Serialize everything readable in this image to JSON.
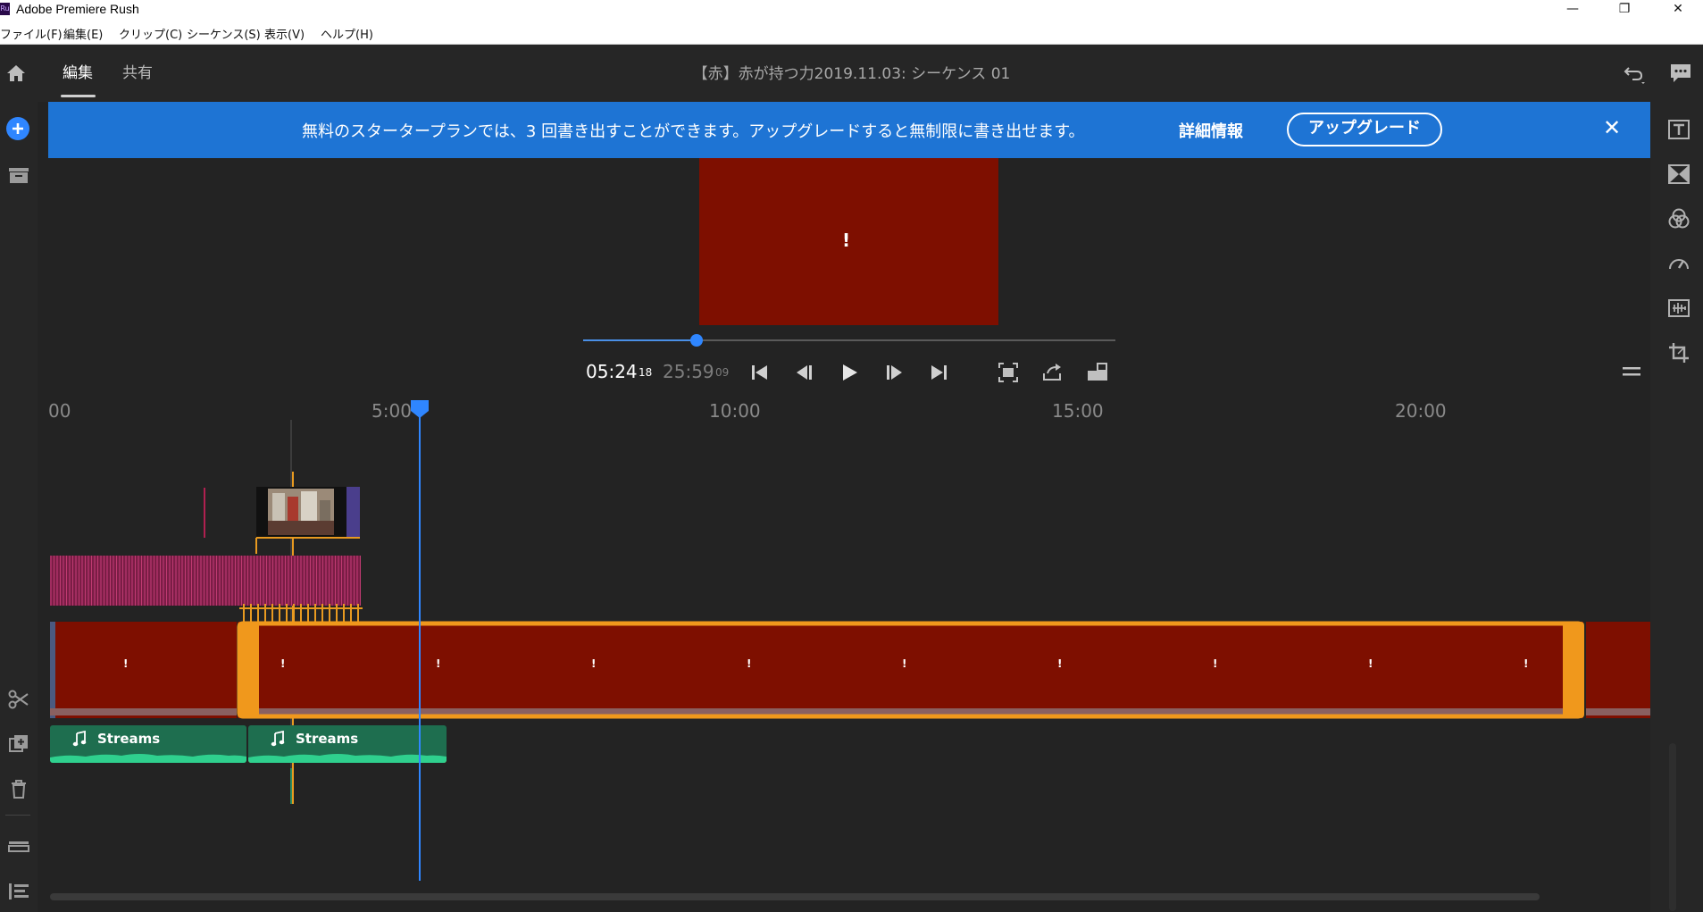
{
  "window": {
    "app_title": "Adobe Premiere Rush",
    "minimize_glyph": "—",
    "restore_glyph": "❐",
    "close_glyph": "✕"
  },
  "menubar": {
    "items": [
      "ファイル(F)",
      "編集(E)",
      "クリップ(C)",
      "シーケンス(S)",
      "表示(V)",
      "ヘルプ(H)"
    ]
  },
  "header": {
    "tabs": [
      {
        "label": "編集",
        "active": true
      },
      {
        "label": "共有",
        "active": false
      }
    ],
    "project_title": "【赤】赤が持つ力2019.11.03: シーケンス 01"
  },
  "banner": {
    "message": "無料のスタータープランでは、3 回書き出すことができます。アップグレードすると無制限に書き出せます。",
    "more_info": "詳細情報",
    "upgrade": "アップグレード",
    "close_glyph": "✕",
    "color": "#1e74d4"
  },
  "preview": {
    "alert": "!",
    "bg_color": "#7e0f00"
  },
  "playback": {
    "current_time": "05:24",
    "current_frames": "18",
    "duration": "25:59",
    "duration_frames": "09",
    "progress": 0.21,
    "controls": [
      "skip-to-start-icon",
      "step-back-icon",
      "play-icon",
      "step-forward-icon",
      "skip-to-end-icon",
      "fit-frame-icon",
      "loop-icon",
      "aspect-ratio-icon"
    ]
  },
  "ruler": {
    "labels": [
      "00",
      "5:00",
      "10:00",
      "15:00",
      "20:00"
    ]
  },
  "timeline": {
    "alert_marker": "!",
    "audio_clips": [
      {
        "label": "Streams"
      },
      {
        "label": "Streams"
      }
    ],
    "clip_color": "#7e0f00",
    "selection_color": "#f0981c",
    "audio_color": "#1e6e4f"
  },
  "rail_icons": {
    "left": [
      "home-icon",
      "add-media-icon",
      "project-icon",
      "split-icon",
      "duplicate-icon",
      "delete-icon",
      "track-toggle-icon",
      "list-icon"
    ],
    "right": [
      "titles-icon",
      "transitions-icon",
      "color-icon",
      "speed-icon",
      "audio-icon",
      "crop-icon"
    ]
  }
}
